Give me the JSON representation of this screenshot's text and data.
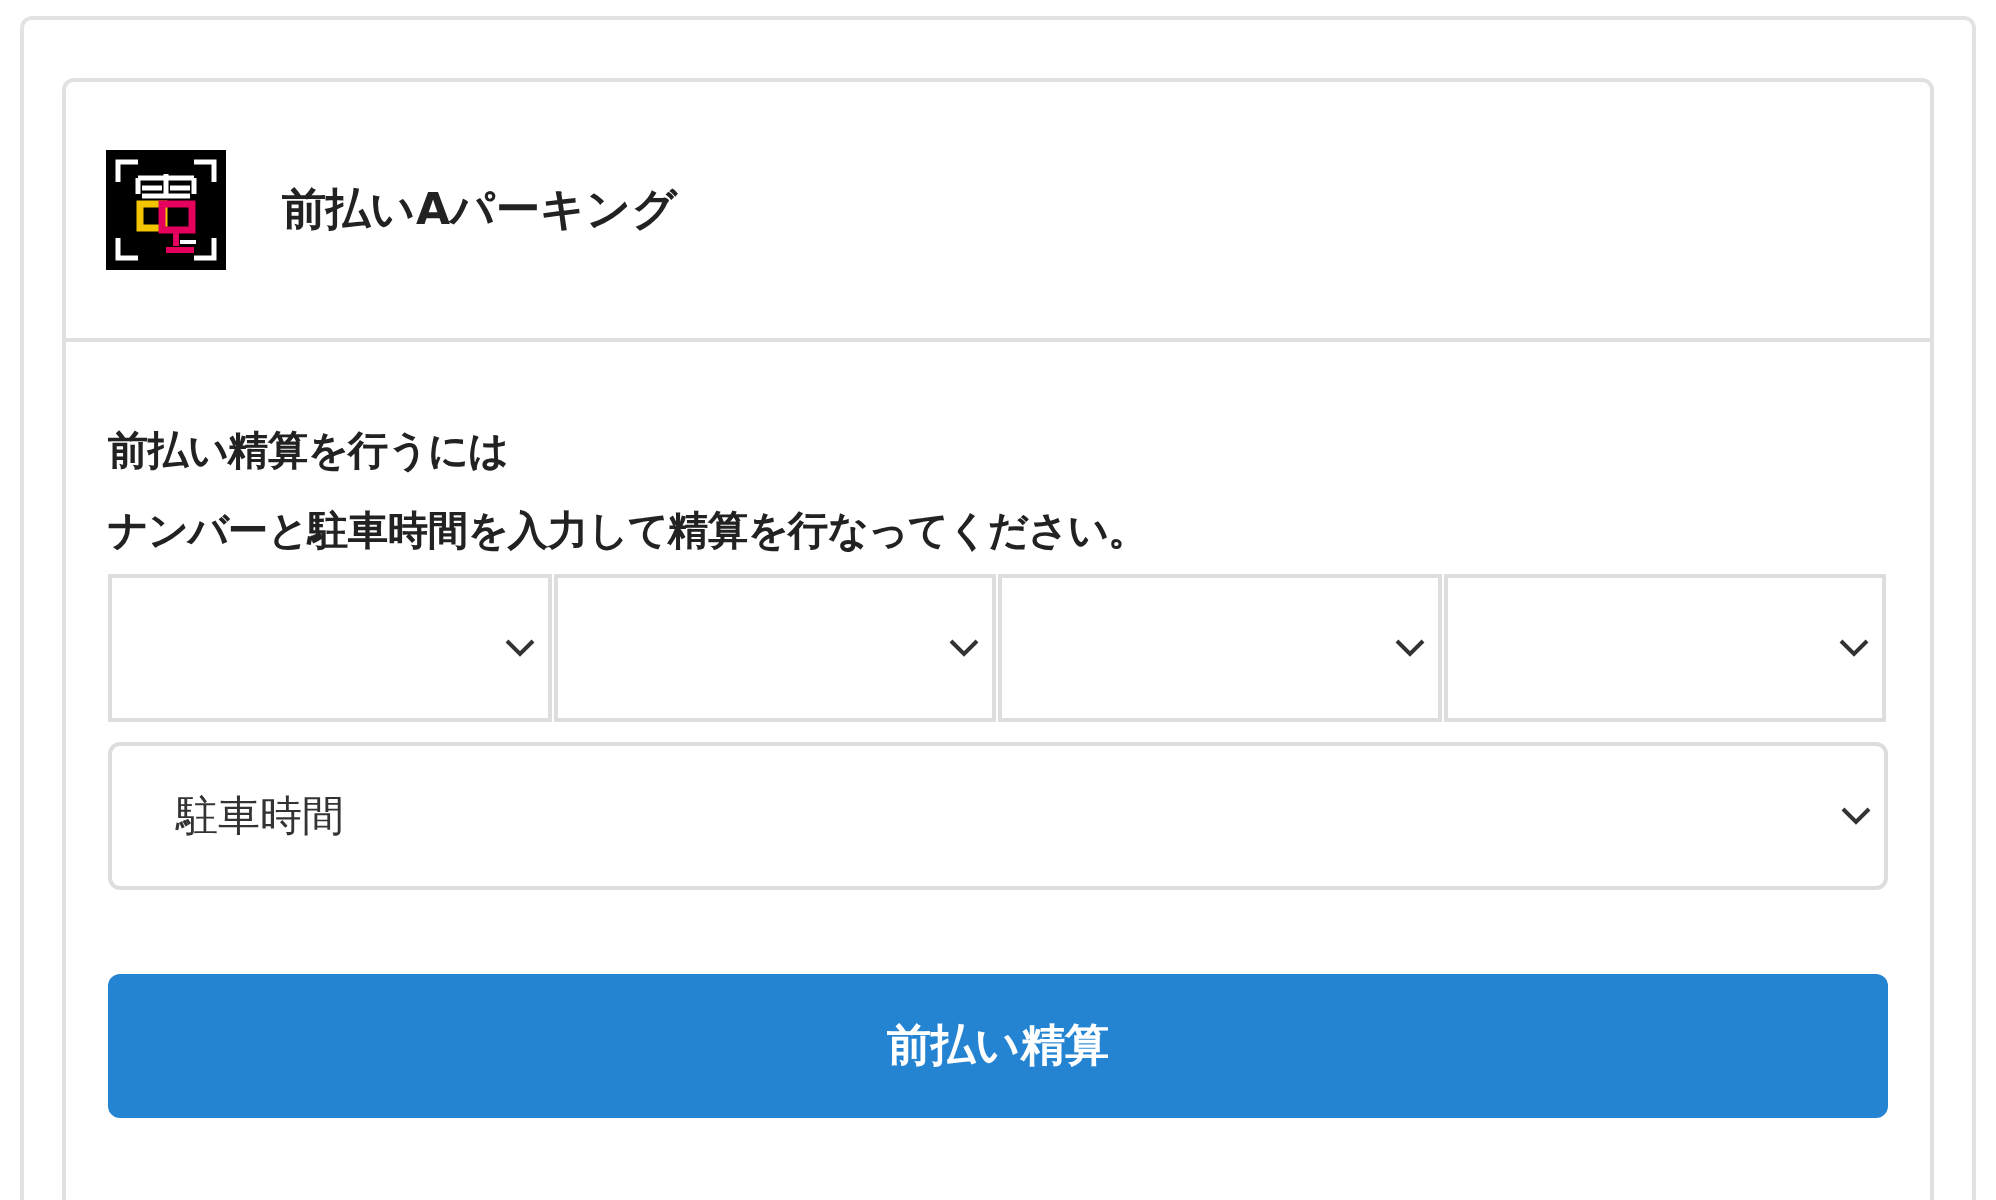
{
  "header": {
    "title": "前払いAパーキング"
  },
  "instructions": [
    "前払い精算を行うには",
    "ナンバーと駐車時間を入力して精算を行なってください。"
  ],
  "plate_fields": [
    {
      "kind": "select"
    },
    {
      "kind": "select"
    },
    {
      "kind": "select"
    },
    {
      "kind": "select"
    }
  ],
  "time_field": {
    "placeholder": "駐車時間"
  },
  "submit_button": {
    "label": "前払い精算"
  }
}
